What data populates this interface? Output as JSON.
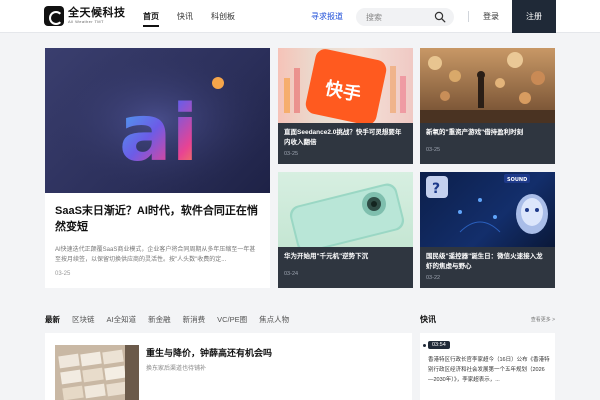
{
  "logo": {
    "title": "全天候科技",
    "subtitle": "All Weather TMT"
  },
  "nav": [
    "首页",
    "快讯",
    "科创板"
  ],
  "header": {
    "seek_report": "寻求报道",
    "search_placeholder": "搜索",
    "login": "登录",
    "register": "注册"
  },
  "hero": {
    "image_text": "ai",
    "title": "SaaS末日渐近？AI时代，软件合同正在悄然变短",
    "desc": "AI快速迭代正颠覆SaaS商业模式，企业客户将合同周期从多年压缩至一年甚至按月续签，以保留切换供应商的灵活性。按\"人头数\"收费的定...",
    "date": "03-25"
  },
  "cards": [
    {
      "title": "直面Seedance2.0挑战？快手可灵想要年内收入翻倍",
      "date": "03-25",
      "logo_text": "快手"
    },
    {
      "title": "新氧的\"重资产游戏\"借持盈利时刻",
      "date": "03-25"
    },
    {
      "title": "华为开始用\"千元机\"逆势下沉",
      "date": "03-24"
    },
    {
      "title": "国民级\"遥控器\"诞生日：微信火速接入龙虾的焦虑与野心",
      "date": "03-22",
      "badge": "SOUND"
    }
  ],
  "tabs": [
    "最新",
    "区块链",
    "AI全知道",
    "新金融",
    "新消费",
    "VC/PE圈",
    "焦点人物"
  ],
  "article": {
    "title": "重生与降价，钟薛高还有机会吗",
    "subtitle": "换东家后渠道也待铺补"
  },
  "flash": {
    "title": "快讯",
    "more": "查看更多 >",
    "time": "03:54",
    "text": "香港特区行政长官李家超今（16日）公布《香港特别行政区经济和社会发展第一个五年规划（2026—2030年）》，李家超表示，..."
  }
}
